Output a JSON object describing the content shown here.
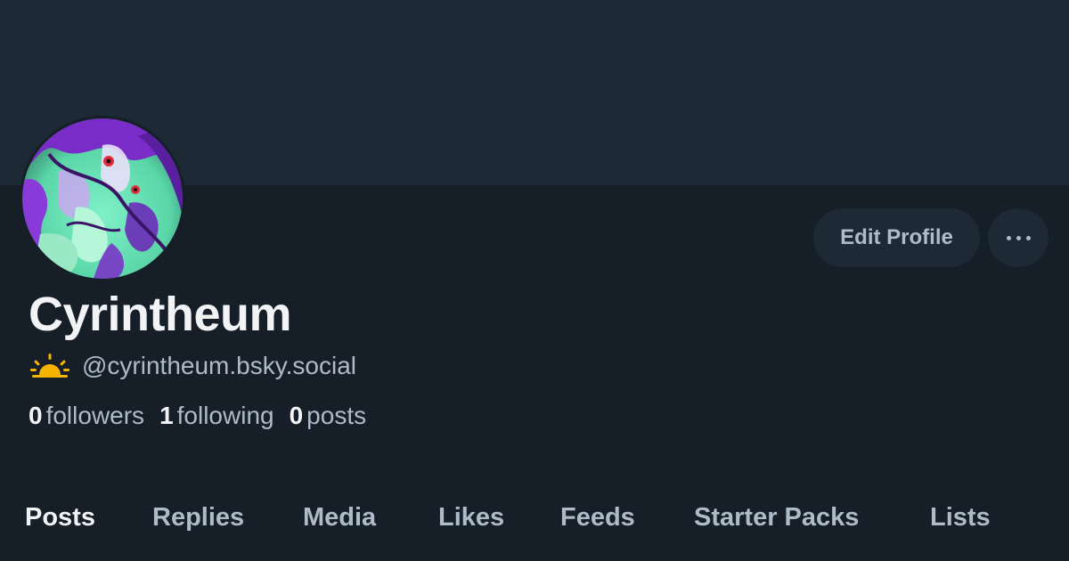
{
  "profile": {
    "display_name": "Cyrintheum",
    "handle": "@cyrintheum.bsky.social",
    "handle_icon": "sunrise-icon",
    "avatar_icon": "abstract-art-avatar"
  },
  "stats": {
    "followers_count": "0",
    "followers_label": "followers",
    "following_count": "1",
    "following_label": "following",
    "posts_count": "0",
    "posts_label": "posts"
  },
  "actions": {
    "edit_label": "Edit Profile",
    "more_icon": "more-horizontal-icon"
  },
  "tabs": [
    {
      "label": "Posts",
      "active": true
    },
    {
      "label": "Replies",
      "active": false
    },
    {
      "label": "Media",
      "active": false
    },
    {
      "label": "Likes",
      "active": false
    },
    {
      "label": "Feeds",
      "active": false
    },
    {
      "label": "Starter Packs",
      "active": false
    },
    {
      "label": "Lists",
      "active": false
    }
  ],
  "colors": {
    "background": "#161e27",
    "banner": "#1e2936",
    "text_primary": "#f1f3f5",
    "text_secondary": "#aebbc9",
    "sun": "#f5b400"
  }
}
